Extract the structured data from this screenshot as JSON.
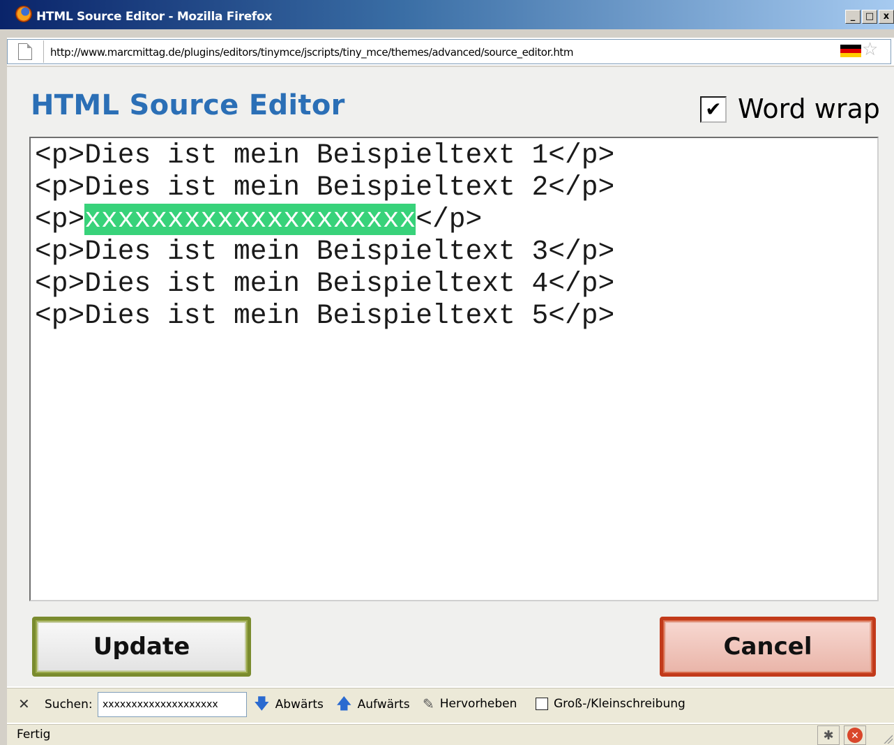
{
  "window": {
    "title": "HTML Source Editor - Mozilla Firefox",
    "minimize": "_",
    "maximize": "□",
    "close": "x"
  },
  "urlbar": {
    "url": "http://www.marcmittag.de/plugins/editors/tinymce/jscripts/tiny_mce/themes/advanced/source_editor.htm"
  },
  "dialog": {
    "heading": "HTML Source Editor",
    "word_wrap_label": "Word wrap",
    "word_wrap_checked": true,
    "word_wrap_mark": "✔",
    "code_lines": [
      {
        "pre": "<p>Dies ist mein Beispieltext 1</p>",
        "hl": "",
        "post": ""
      },
      {
        "pre": "<p>Dies ist mein Beispieltext 2</p>",
        "hl": "",
        "post": ""
      },
      {
        "pre": "<p>",
        "hl": "xxxxxxxxxxxxxxxxxxxx",
        "post": "</p>"
      },
      {
        "pre": "<p>Dies ist mein Beispieltext 3</p>",
        "hl": "",
        "post": ""
      },
      {
        "pre": "<p>Dies ist mein Beispieltext 4</p>",
        "hl": "",
        "post": ""
      },
      {
        "pre": "<p>Dies ist mein Beispieltext 5</p>",
        "hl": "",
        "post": ""
      }
    ],
    "highlight_color": "#38d27a",
    "update_label": "Update",
    "cancel_label": "Cancel"
  },
  "findbar": {
    "close_glyph": "✕",
    "search_label": "Suchen:",
    "search_value": "xxxxxxxxxxxxxxxxxxxx",
    "down_label": "Abwärts",
    "up_label": "Aufwärts",
    "highlight_label": "Hervorheben",
    "case_label": "Groß-/Kleinschreibung"
  },
  "statusbar": {
    "status": "Fertig"
  },
  "colors": {
    "heading": "#2b6fb6",
    "update_border": "#7a8b2e",
    "cancel_border": "#c23a1a"
  }
}
